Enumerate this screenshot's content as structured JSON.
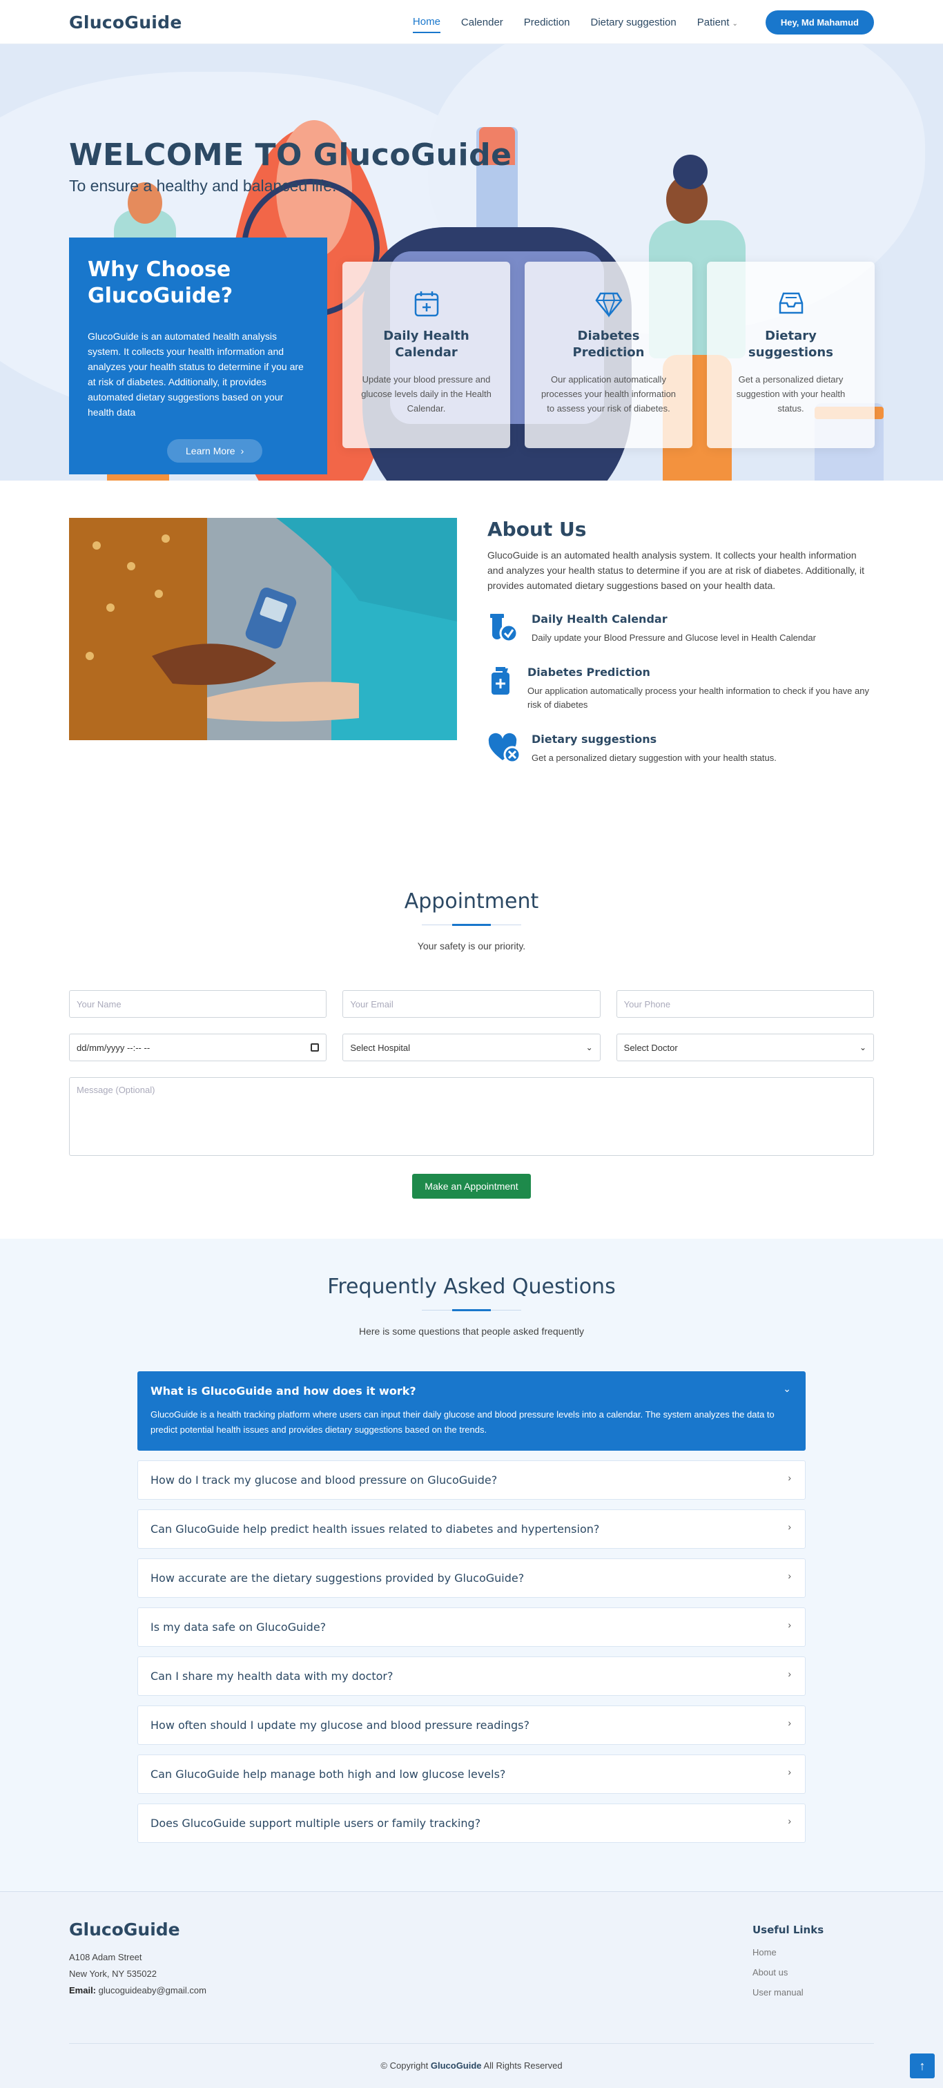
{
  "header": {
    "logo": "GlucoGuide",
    "nav": [
      {
        "label": "Home",
        "active": true
      },
      {
        "label": "Calender"
      },
      {
        "label": "Prediction"
      },
      {
        "label": "Dietary suggestion"
      },
      {
        "label": "Patient"
      }
    ],
    "user_button": "Hey, Md Mahamud"
  },
  "hero": {
    "title": "WELCOME TO GlucoGuide",
    "subtitle": "To ensure a healthy and balanced life.",
    "why": {
      "title": "Why Choose GlucoGuide?",
      "text": "GlucoGuide is an automated health analysis system. It collects your health information and analyzes your health status to determine if you are at risk of diabetes. Additionally, it provides automated dietary suggestions based on your health data",
      "button": "Learn More"
    },
    "cards": [
      {
        "icon": "calendar-plus-icon",
        "title": "Daily Health Calendar",
        "text": "Update your blood pressure and glucose levels daily in the Health Calendar."
      },
      {
        "icon": "diamond-icon",
        "title": "Diabetes Prediction",
        "text": "Our application automatically processes your health information to assess your risk of diabetes."
      },
      {
        "icon": "inbox-icon",
        "title": "Dietary suggestions",
        "text": "Get a personalized dietary suggestion with your health status."
      }
    ]
  },
  "about": {
    "title": "About Us",
    "text": "GlucoGuide is an automated health analysis system. It collects your health information and analyzes your health status to determine if you are at risk of diabetes. Additionally, it provides automated dietary suggestions based on your health data.",
    "items": [
      {
        "icon": "test-tube-icon",
        "title": "Daily Health Calendar",
        "text": "Daily update your Blood Pressure and Glucose level in Health Calendar"
      },
      {
        "icon": "medicine-bottle-icon",
        "title": "Diabetes Prediction",
        "text": "Our application automatically process your health information to check if you have any risk of diabetes"
      },
      {
        "icon": "heart-icon",
        "title": "Dietary suggestions",
        "text": "Get a personalized dietary suggestion with your health status."
      }
    ]
  },
  "appointment": {
    "title": "Appointment",
    "subtitle": "Your safety is our priority.",
    "name_placeholder": "Your Name",
    "email_placeholder": "Your Email",
    "phone_placeholder": "Your Phone",
    "date_value": "dd/mm/yyyy --:-- --",
    "hospital_value": "Select Hospital",
    "doctor_value": "Select Doctor",
    "message_placeholder": "Message (Optional)",
    "submit": "Make an Appointment"
  },
  "faq": {
    "title": "Frequently Asked Questions",
    "subtitle": "Here is some questions that people asked frequently",
    "items": [
      {
        "q": "What is GlucoGuide and how does it work?",
        "a": "GlucoGuide is a health tracking platform where users can input their daily glucose and blood pressure levels into a calendar. The system analyzes the data to predict potential health issues and provides dietary suggestions based on the trends.",
        "open": true
      },
      {
        "q": "How do I track my glucose and blood pressure on GlucoGuide?"
      },
      {
        "q": "Can GlucoGuide help predict health issues related to diabetes and hypertension?"
      },
      {
        "q": "How accurate are the dietary suggestions provided by GlucoGuide?"
      },
      {
        "q": "Is my data safe on GlucoGuide?"
      },
      {
        "q": "Can I share my health data with my doctor?"
      },
      {
        "q": "How often should I update my glucose and blood pressure readings?"
      },
      {
        "q": "Can GlucoGuide help manage both high and low glucose levels?"
      },
      {
        "q": "Does GlucoGuide support multiple users or family tracking?"
      }
    ]
  },
  "footer": {
    "logo": "GlucoGuide",
    "address1": "A108 Adam Street",
    "address2": "New York, NY 535022",
    "email_label": "Email:",
    "email": "glucoguideaby@gmail.com",
    "links_title": "Useful Links",
    "links": [
      "Home",
      "About us",
      "User manual"
    ],
    "copyright_prefix": "© Copyright",
    "copyright_brand": "GlucoGuide",
    "copyright_suffix": "All Rights Reserved"
  },
  "colors": {
    "primary": "#1977cc",
    "heading": "#2c4964",
    "submit": "#1e8a4b"
  }
}
